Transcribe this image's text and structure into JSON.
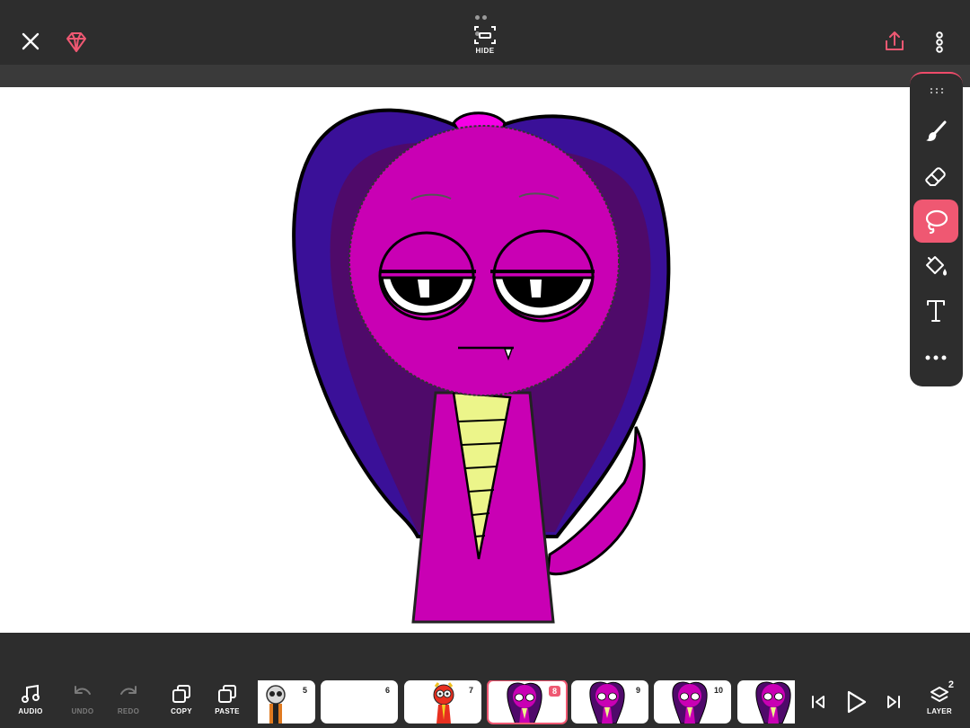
{
  "topbar": {
    "hide_label": "HIDE"
  },
  "toolbar": {
    "tools": [
      "brush",
      "eraser",
      "lasso",
      "fill",
      "text",
      "more"
    ],
    "active_tool": "lasso"
  },
  "bottombar": {
    "audio_label": "AUDIO",
    "undo_label": "UNDO",
    "redo_label": "REDO",
    "copy_label": "COPY",
    "paste_label": "PASTE",
    "layer_label": "LAYER",
    "layer_count": "2"
  },
  "frames": [
    {
      "num": "5",
      "thumb": "skeleton"
    },
    {
      "num": "6",
      "thumb": "blank"
    },
    {
      "num": "7",
      "thumb": "red-character"
    },
    {
      "num": "8",
      "thumb": "purple-snake",
      "current": true
    },
    {
      "num": "9",
      "thumb": "purple-snake"
    },
    {
      "num": "10",
      "thumb": "purple-snake"
    },
    {
      "num": "",
      "thumb": "purple-snake"
    }
  ],
  "colors": {
    "accent": "#ef5872",
    "bar": "#2d2d2d",
    "canvas": "#ffffff",
    "snake_body": "#c900b4",
    "hood_outer": "#3a1098",
    "hood_inner": "#4f0a6a",
    "belly": "#ecf58a"
  }
}
